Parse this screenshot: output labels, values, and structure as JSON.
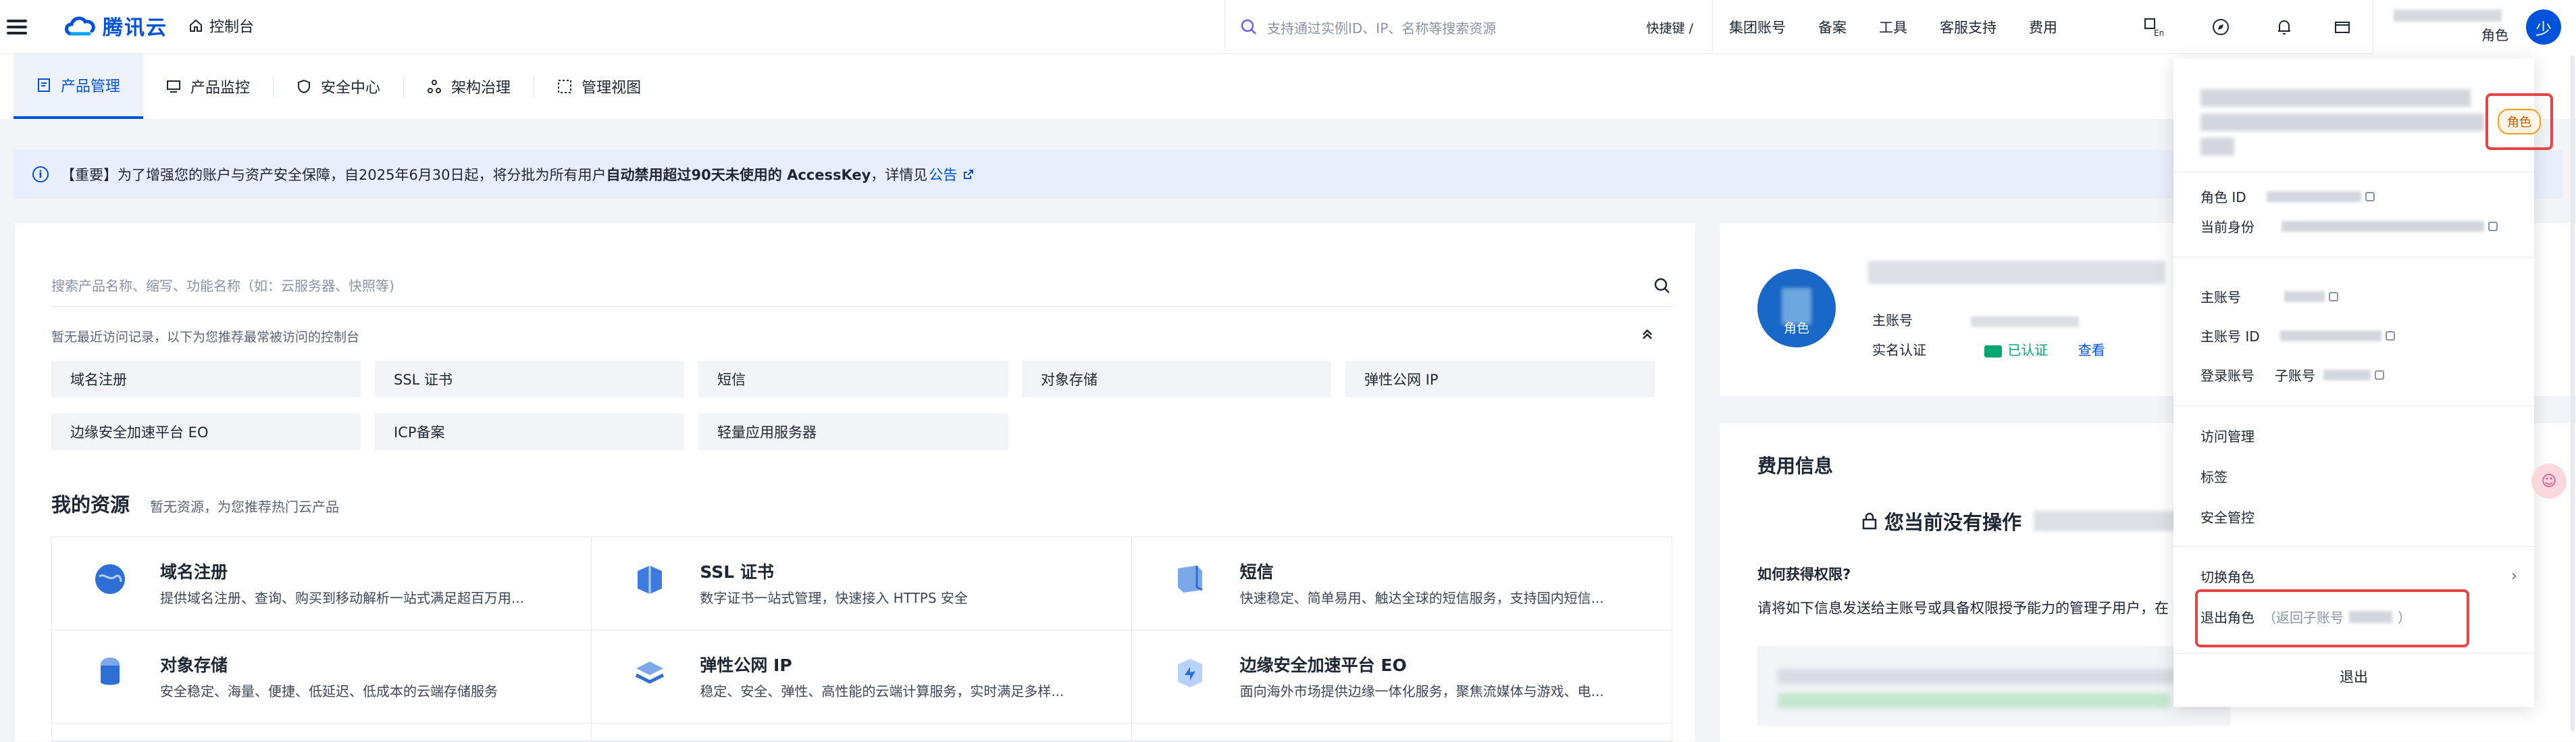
{
  "header": {
    "logo_text": "腾讯云",
    "console_label": "控制台",
    "search_placeholder": "支持通过实例ID、IP、名称等搜索资源",
    "shortcut_label": "快捷键 /",
    "nav": [
      "集团账号",
      "备案",
      "工具",
      "客服支持",
      "费用"
    ],
    "role_label": "角色",
    "avatar_initial": "少"
  },
  "tabs": [
    {
      "label": "产品管理",
      "active": true
    },
    {
      "label": "产品监控",
      "active": false
    },
    {
      "label": "安全中心",
      "active": false
    },
    {
      "label": "架构治理",
      "active": false
    },
    {
      "label": "管理视图",
      "active": false
    }
  ],
  "notice": {
    "prefix": "【重要】为了增强您的账户与资产安全保障，自2025年6月30日起，将分批为所有用户",
    "bold": "自动禁用超过90天未使用的 AccessKey",
    "suffix": "，详情见",
    "link": "公告"
  },
  "main": {
    "search_placeholder": "搜索产品名称、缩写、功能名称（如：云服务器、快照等)",
    "recent_hint": "暂无最近访问记录，以下为您推荐最常被访问的控制台",
    "quick_links": [
      "域名注册",
      "SSL 证书",
      "短信",
      "对象存储",
      "弹性公网 IP",
      "边缘安全加速平台 EO",
      "ICP备案",
      "轻量应用服务器"
    ],
    "resources_title": "我的资源",
    "resources_subtitle": "暂无资源，为您推荐热门云产品",
    "products": [
      {
        "name": "域名注册",
        "desc": "提供域名注册、查询、购买到移动解析一站式满足超百万用..."
      },
      {
        "name": "SSL 证书",
        "desc": "数字证书一站式管理，快速接入 HTTPS 安全"
      },
      {
        "name": "短信",
        "desc": "快速稳定、简单易用、触达全球的短信服务，支持国内短信..."
      },
      {
        "name": "对象存储",
        "desc": "安全稳定、海量、便捷、低延迟、低成本的云端存储服务"
      },
      {
        "name": "弹性公网 IP",
        "desc": "稳定、安全、弹性、高性能的云端计算服务，实时满足多样..."
      },
      {
        "name": "边缘安全加速平台 EO",
        "desc": "面向海外市场提供边缘一体化服务，聚焦流媒体与游戏、电..."
      }
    ]
  },
  "user_card": {
    "avatar_label": "角色",
    "main_account_label": "主账号",
    "realname_label": "实名认证",
    "verified_text": "已认证",
    "view_link": "查看"
  },
  "fee_card": {
    "title": "费用信息",
    "no_op": "您当前没有操作",
    "question": "如何获得权限?",
    "desc": "请将如下信息发送给主账号或具备权限授予能力的管理子用户，在"
  },
  "dropdown": {
    "role_badge": "角色",
    "role_id_label": "角色 ID",
    "current_identity_label": "当前身份",
    "main_account_label": "主账号",
    "main_account_id_label": "主账号 ID",
    "login_account_label": "登录账号",
    "login_account_value": "子账号",
    "links": [
      "访问管理",
      "标签",
      "安全管控"
    ],
    "switch_role": "切换角色",
    "exit_role": "退出角色",
    "exit_role_sub_prefix": "（返回子账号",
    "exit_role_sub_suffix": "）",
    "logout": "退出"
  },
  "colors": {
    "brand": "#0052d9",
    "highlight": "#e54545",
    "success": "#00a870"
  }
}
